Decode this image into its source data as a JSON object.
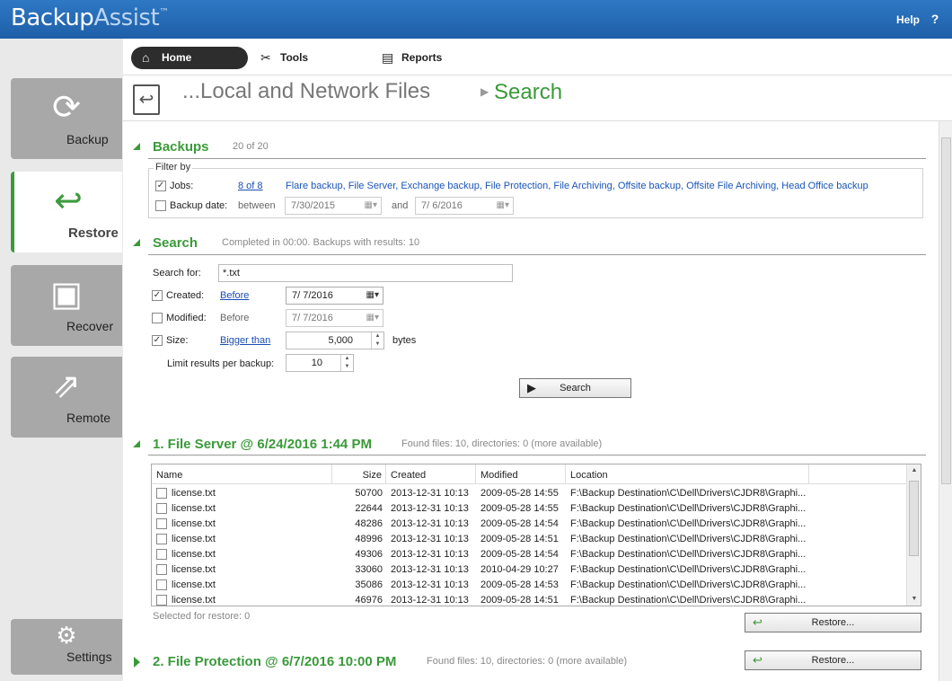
{
  "app": {
    "brand_part1": "Backup",
    "brand_part2": "Assist",
    "trademark": "™",
    "help_label": "Help",
    "help_icon": "?"
  },
  "sidebar": {
    "items": [
      {
        "label": "Backup",
        "icon": "refresh-icon",
        "active": false
      },
      {
        "label": "Restore",
        "icon": "restore-icon",
        "active": true
      },
      {
        "label": "Recover",
        "icon": "recover-icon",
        "active": false
      },
      {
        "label": "Remote",
        "icon": "remote-icon",
        "active": false
      }
    ],
    "settings_label": "Settings"
  },
  "nav": {
    "tabs": [
      {
        "label": "Home"
      },
      {
        "label": "Tools"
      },
      {
        "label": "Reports"
      }
    ]
  },
  "breadcrumb": {
    "parent": "...Local and Network Files",
    "current": "Search"
  },
  "backups": {
    "title": "Backups",
    "count": "20 of 20",
    "filter_by": "Filter by",
    "jobs_label": "Jobs:",
    "jobs_link": "8 of 8",
    "jobs_list": "Flare backup, File Server, Exchange backup, File Protection, File Archiving, Offsite backup, Offsite File Archiving, Head Office backup",
    "jobs_checked": true,
    "date_label": "Backup date:",
    "between": "between",
    "date_from": "7/30/2015",
    "and": "and",
    "date_to": "7/  6/2016",
    "date_checked": false
  },
  "search": {
    "title": "Search",
    "status": "Completed in 00:00. Backups with results: 10",
    "search_for_label": "Search for:",
    "search_for_value": "*.txt",
    "created_label": "Created:",
    "created_checked": true,
    "created_link": "Before",
    "created_date": "7/  7/2016",
    "modified_label": "Modified:",
    "modified_checked": false,
    "modified_mode": "Before",
    "modified_date": "7/  7/2016",
    "size_label": "Size:",
    "size_checked": true,
    "size_link": "Bigger than",
    "size_value": "5,000",
    "size_unit": "bytes",
    "limit_label": "Limit results per backup:",
    "limit_value": "10",
    "search_button": "Search"
  },
  "results": [
    {
      "title": "1. File Server @ 6/24/2016 1:44 PM",
      "meta": "Found files: 10, directories: 0 (more available)",
      "columns": [
        "Name",
        "Size",
        "Created",
        "Modified",
        "Location"
      ],
      "rows": [
        [
          "license.txt",
          "50700",
          "2013-12-31 10:13",
          "2009-05-28 14:55",
          "F:\\Backup Destination\\C\\Dell\\Drivers\\CJDR8\\Graphi..."
        ],
        [
          "license.txt",
          "22644",
          "2013-12-31 10:13",
          "2009-05-28 14:55",
          "F:\\Backup Destination\\C\\Dell\\Drivers\\CJDR8\\Graphi..."
        ],
        [
          "license.txt",
          "48286",
          "2013-12-31 10:13",
          "2009-05-28 14:54",
          "F:\\Backup Destination\\C\\Dell\\Drivers\\CJDR8\\Graphi..."
        ],
        [
          "license.txt",
          "48996",
          "2013-12-31 10:13",
          "2009-05-28 14:51",
          "F:\\Backup Destination\\C\\Dell\\Drivers\\CJDR8\\Graphi..."
        ],
        [
          "license.txt",
          "49306",
          "2013-12-31 10:13",
          "2009-05-28 14:54",
          "F:\\Backup Destination\\C\\Dell\\Drivers\\CJDR8\\Graphi..."
        ],
        [
          "license.txt",
          "33060",
          "2013-12-31 10:13",
          "2010-04-29 10:27",
          "F:\\Backup Destination\\C\\Dell\\Drivers\\CJDR8\\Graphi..."
        ],
        [
          "license.txt",
          "35086",
          "2013-12-31 10:13",
          "2009-05-28 14:53",
          "F:\\Backup Destination\\C\\Dell\\Drivers\\CJDR8\\Graphi..."
        ],
        [
          "license.txt",
          "46976",
          "2013-12-31 10:13",
          "2009-05-28 14:51",
          "F:\\Backup Destination\\C\\Dell\\Drivers\\CJDR8\\Graphi..."
        ]
      ],
      "selected": "Selected for restore: 0",
      "restore_button": "Restore..."
    },
    {
      "title": "2. File Protection @ 6/7/2016 10:00 PM",
      "meta": "Found files: 10, directories: 0 (more available)",
      "restore_button": "Restore..."
    }
  ],
  "colors": {
    "brand_blue": "#1f5fa8",
    "accent_green": "#3a9a3a",
    "link_blue": "#1a4db3"
  }
}
